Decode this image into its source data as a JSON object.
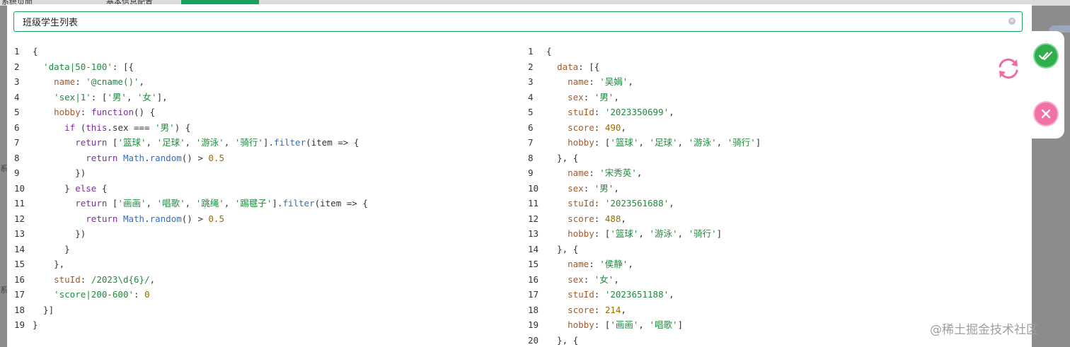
{
  "background": {
    "tabs": [
      "系统页面",
      "基本信息配置"
    ],
    "side_glyph": "系"
  },
  "dialog": {
    "title_value": "班级学生列表",
    "clear_icon": "circle-close-icon"
  },
  "template_code": [
    [
      [
        "{",
        "plain"
      ]
    ],
    [
      [
        "  ",
        "plain"
      ],
      [
        "'data|50-100'",
        "str"
      ],
      [
        ": [{",
        "plain"
      ]
    ],
    [
      [
        "    ",
        "plain"
      ],
      [
        "name",
        "prop"
      ],
      [
        ": ",
        "plain"
      ],
      [
        "'@cname()'",
        "str"
      ],
      [
        ",",
        "plain"
      ]
    ],
    [
      [
        "    ",
        "plain"
      ],
      [
        "'sex|1'",
        "str"
      ],
      [
        ": [",
        "plain"
      ],
      [
        "'男'",
        "str"
      ],
      [
        ", ",
        "plain"
      ],
      [
        "'女'",
        "str"
      ],
      [
        "],",
        "plain"
      ]
    ],
    [
      [
        "    ",
        "plain"
      ],
      [
        "hobby",
        "prop"
      ],
      [
        ": ",
        "plain"
      ],
      [
        "function",
        "key"
      ],
      [
        "() {",
        "plain"
      ]
    ],
    [
      [
        "      ",
        "plain"
      ],
      [
        "if",
        "key"
      ],
      [
        " (",
        "plain"
      ],
      [
        "this",
        "key"
      ],
      [
        ".sex === ",
        "plain"
      ],
      [
        "'男'",
        "str"
      ],
      [
        ") {",
        "plain"
      ]
    ],
    [
      [
        "        ",
        "plain"
      ],
      [
        "return",
        "key"
      ],
      [
        " [",
        "plain"
      ],
      [
        "'篮球'",
        "str"
      ],
      [
        ", ",
        "plain"
      ],
      [
        "'足球'",
        "str"
      ],
      [
        ", ",
        "plain"
      ],
      [
        "'游泳'",
        "str"
      ],
      [
        ", ",
        "plain"
      ],
      [
        "'骑行'",
        "str"
      ],
      [
        "].",
        "plain"
      ],
      [
        "filter",
        "fn"
      ],
      [
        "(item => {",
        "plain"
      ]
    ],
    [
      [
        "          ",
        "plain"
      ],
      [
        "return",
        "key"
      ],
      [
        " ",
        "plain"
      ],
      [
        "Math",
        "fn"
      ],
      [
        ".",
        "plain"
      ],
      [
        "random",
        "fn"
      ],
      [
        "() > ",
        "plain"
      ],
      [
        "0.5",
        "num"
      ]
    ],
    [
      [
        "        })",
        "plain"
      ]
    ],
    [
      [
        "      } ",
        "plain"
      ],
      [
        "else",
        "key"
      ],
      [
        " {",
        "plain"
      ]
    ],
    [
      [
        "        ",
        "plain"
      ],
      [
        "return",
        "key"
      ],
      [
        " [",
        "plain"
      ],
      [
        "'画画'",
        "str"
      ],
      [
        ", ",
        "plain"
      ],
      [
        "'唱歌'",
        "str"
      ],
      [
        ", ",
        "plain"
      ],
      [
        "'跳绳'",
        "str"
      ],
      [
        ", ",
        "plain"
      ],
      [
        "'踢毽子'",
        "str"
      ],
      [
        "].",
        "plain"
      ],
      [
        "filter",
        "fn"
      ],
      [
        "(item => {",
        "plain"
      ]
    ],
    [
      [
        "          ",
        "plain"
      ],
      [
        "return",
        "key"
      ],
      [
        " ",
        "plain"
      ],
      [
        "Math",
        "fn"
      ],
      [
        ".",
        "plain"
      ],
      [
        "random",
        "fn"
      ],
      [
        "() > ",
        "plain"
      ],
      [
        "0.5",
        "num"
      ]
    ],
    [
      [
        "        })",
        "plain"
      ]
    ],
    [
      [
        "      }",
        "plain"
      ]
    ],
    [
      [
        "    },",
        "plain"
      ]
    ],
    [
      [
        "    ",
        "plain"
      ],
      [
        "stuId",
        "prop"
      ],
      [
        ": ",
        "plain"
      ],
      [
        "/2023\\d{6}/",
        "str"
      ],
      [
        ",",
        "plain"
      ]
    ],
    [
      [
        "    ",
        "plain"
      ],
      [
        "'score|200-600'",
        "str"
      ],
      [
        ": ",
        "plain"
      ],
      [
        "0",
        "num"
      ]
    ],
    [
      [
        "  }]",
        "plain"
      ]
    ],
    [
      [
        "}",
        "plain"
      ]
    ]
  ],
  "result_code": [
    [
      [
        "{",
        "plain"
      ]
    ],
    [
      [
        "  ",
        "plain"
      ],
      [
        "data",
        "prop"
      ],
      [
        ": [{",
        "plain"
      ]
    ],
    [
      [
        "    ",
        "plain"
      ],
      [
        "name",
        "prop"
      ],
      [
        ": ",
        "plain"
      ],
      [
        "'吴娟'",
        "str"
      ],
      [
        ",",
        "plain"
      ]
    ],
    [
      [
        "    ",
        "plain"
      ],
      [
        "sex",
        "prop"
      ],
      [
        ": ",
        "plain"
      ],
      [
        "'男'",
        "str"
      ],
      [
        ",",
        "plain"
      ]
    ],
    [
      [
        "    ",
        "plain"
      ],
      [
        "stuId",
        "prop"
      ],
      [
        ": ",
        "plain"
      ],
      [
        "'2023350699'",
        "str"
      ],
      [
        ",",
        "plain"
      ]
    ],
    [
      [
        "    ",
        "plain"
      ],
      [
        "score",
        "prop"
      ],
      [
        ": ",
        "plain"
      ],
      [
        "490",
        "num"
      ],
      [
        ",",
        "plain"
      ]
    ],
    [
      [
        "    ",
        "plain"
      ],
      [
        "hobby",
        "prop"
      ],
      [
        ": [",
        "plain"
      ],
      [
        "'篮球'",
        "str"
      ],
      [
        ", ",
        "plain"
      ],
      [
        "'足球'",
        "str"
      ],
      [
        ", ",
        "plain"
      ],
      [
        "'游泳'",
        "str"
      ],
      [
        ", ",
        "plain"
      ],
      [
        "'骑行'",
        "str"
      ],
      [
        "]",
        "plain"
      ]
    ],
    [
      [
        "  }, {",
        "plain"
      ]
    ],
    [
      [
        "    ",
        "plain"
      ],
      [
        "name",
        "prop"
      ],
      [
        ": ",
        "plain"
      ],
      [
        "'宋秀英'",
        "str"
      ],
      [
        ",",
        "plain"
      ]
    ],
    [
      [
        "    ",
        "plain"
      ],
      [
        "sex",
        "prop"
      ],
      [
        ": ",
        "plain"
      ],
      [
        "'男'",
        "str"
      ],
      [
        ",",
        "plain"
      ]
    ],
    [
      [
        "    ",
        "plain"
      ],
      [
        "stuId",
        "prop"
      ],
      [
        ": ",
        "plain"
      ],
      [
        "'2023561688'",
        "str"
      ],
      [
        ",",
        "plain"
      ]
    ],
    [
      [
        "    ",
        "plain"
      ],
      [
        "score",
        "prop"
      ],
      [
        ": ",
        "plain"
      ],
      [
        "488",
        "num"
      ],
      [
        ",",
        "plain"
      ]
    ],
    [
      [
        "    ",
        "plain"
      ],
      [
        "hobby",
        "prop"
      ],
      [
        ": [",
        "plain"
      ],
      [
        "'篮球'",
        "str"
      ],
      [
        ", ",
        "plain"
      ],
      [
        "'游泳'",
        "str"
      ],
      [
        ", ",
        "plain"
      ],
      [
        "'骑行'",
        "str"
      ],
      [
        "]",
        "plain"
      ]
    ],
    [
      [
        "  }, {",
        "plain"
      ]
    ],
    [
      [
        "    ",
        "plain"
      ],
      [
        "name",
        "prop"
      ],
      [
        ": ",
        "plain"
      ],
      [
        "'侯静'",
        "str"
      ],
      [
        ",",
        "plain"
      ]
    ],
    [
      [
        "    ",
        "plain"
      ],
      [
        "sex",
        "prop"
      ],
      [
        ": ",
        "plain"
      ],
      [
        "'女'",
        "str"
      ],
      [
        ",",
        "plain"
      ]
    ],
    [
      [
        "    ",
        "plain"
      ],
      [
        "stuId",
        "prop"
      ],
      [
        ": ",
        "plain"
      ],
      [
        "'2023651188'",
        "str"
      ],
      [
        ",",
        "plain"
      ]
    ],
    [
      [
        "    ",
        "plain"
      ],
      [
        "score",
        "prop"
      ],
      [
        ": ",
        "plain"
      ],
      [
        "214",
        "num"
      ],
      [
        ",",
        "plain"
      ]
    ],
    [
      [
        "    ",
        "plain"
      ],
      [
        "hobby",
        "prop"
      ],
      [
        ": [",
        "plain"
      ],
      [
        "'画画'",
        "str"
      ],
      [
        ", ",
        "plain"
      ],
      [
        "'唱歌'",
        "str"
      ],
      [
        "]",
        "plain"
      ]
    ],
    [
      [
        "  }, {",
        "plain"
      ]
    ]
  ],
  "actions": {
    "refresh_icon": "refresh-icon",
    "confirm_icon": "double-check-icon",
    "cancel_icon": "close-icon"
  },
  "colors": {
    "accent_green": "#1aa15f",
    "confirm_green": "#2fae4e",
    "cancel_pink": "#f272a8",
    "refresh_pink": "#f06aa5",
    "string": "#1e8a3e",
    "property": "#a35a2a",
    "keyword": "#7a2fa0",
    "function": "#2f6ec8",
    "number": "#9a6b00"
  },
  "watermark": "@稀土掘金技术社区"
}
